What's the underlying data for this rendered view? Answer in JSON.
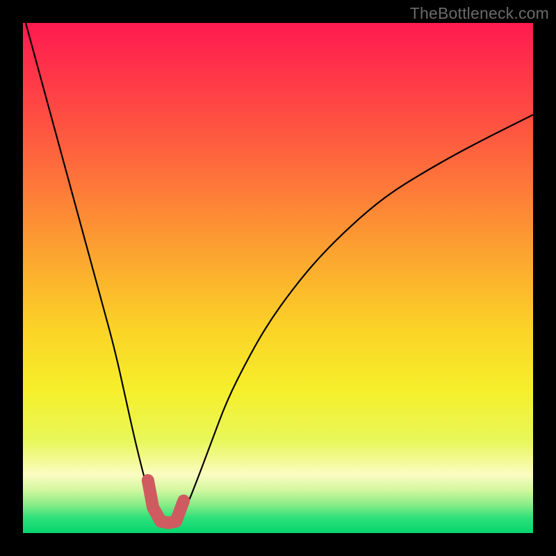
{
  "watermark": "TheBottleneck.com",
  "colors": {
    "frame": "#000000",
    "curve": "#000000",
    "marker": "#cf5b60",
    "gradient_stops": [
      {
        "offset": 0.0,
        "color": "#ff1a50"
      },
      {
        "offset": 0.12,
        "color": "#ff3b47"
      },
      {
        "offset": 0.28,
        "color": "#fe6b3c"
      },
      {
        "offset": 0.45,
        "color": "#fca330"
      },
      {
        "offset": 0.6,
        "color": "#fbd327"
      },
      {
        "offset": 0.72,
        "color": "#f6ef2a"
      },
      {
        "offset": 0.82,
        "color": "#e8f75a"
      },
      {
        "offset": 0.885,
        "color": "#fbfcc1"
      },
      {
        "offset": 0.915,
        "color": "#d4f7a0"
      },
      {
        "offset": 0.945,
        "color": "#86ec86"
      },
      {
        "offset": 0.97,
        "color": "#2ee07a"
      },
      {
        "offset": 1.0,
        "color": "#07d56e"
      }
    ]
  },
  "chart_data": {
    "type": "line",
    "title": "",
    "xlabel": "",
    "ylabel": "",
    "xlim": [
      0,
      100
    ],
    "ylim": [
      0,
      100
    ],
    "grid": false,
    "legend": false,
    "series": [
      {
        "name": "bottleneck-curve",
        "x": [
          0,
          3,
          6,
          9,
          12,
          15,
          18,
          20,
          22,
          24,
          25.5,
          27,
          28.5,
          30,
          32,
          34,
          37,
          40,
          44,
          48,
          53,
          58,
          64,
          71,
          79,
          88,
          100
        ],
        "y": [
          102,
          91,
          80,
          69,
          58,
          47,
          36,
          27,
          18,
          10,
          5,
          2.3,
          2.0,
          2.3,
          5,
          10,
          18,
          26,
          34,
          41,
          48,
          54,
          60,
          66,
          71,
          76,
          82
        ]
      }
    ],
    "highlight_range_x": [
      24.5,
      31.5
    ],
    "description": "V-shaped bottleneck curve plotted over a vertical red-to-green heat gradient. The steep descending branch originates near the top-left (x≈0, y≈100) and falls to a minimum near x≈28, y≈2. The ascending branch rises more gently toward the upper-right, exiting the frame around x=100, y≈82. A thick salmon-colored U-shaped marker sits over the trough between x≈24.5 and x≈31.5."
  }
}
